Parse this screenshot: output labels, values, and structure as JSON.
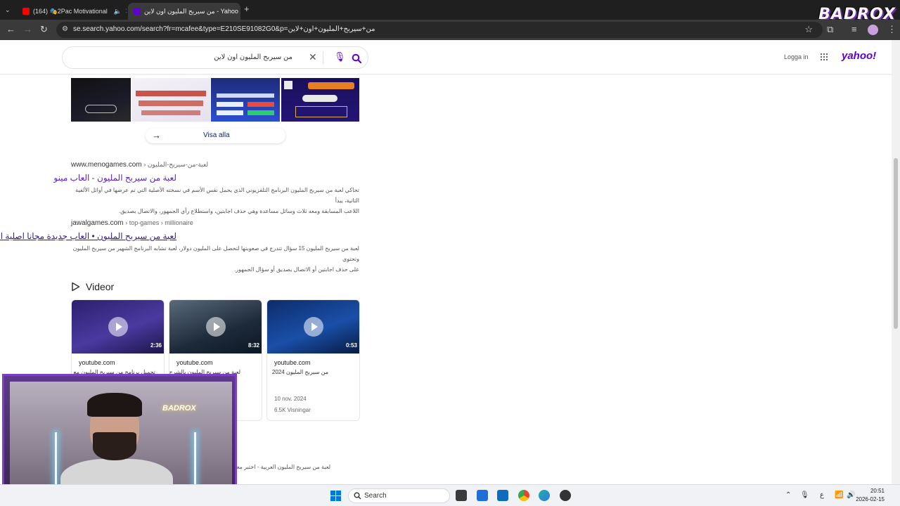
{
  "browser": {
    "tabs": [
      {
        "label": "(164) 🎭2Pac Motivational",
        "active": false
      },
      {
        "label": "من سيربح المليون اون لاين - Yahoo Resultat",
        "active": true
      }
    ],
    "url": "se.search.yahoo.com/search?fr=mcafee&type=E210SE91082G0&p=من+سيربح+المليون+اون+لاين",
    "overlay_logo": "BADROX"
  },
  "header": {
    "search_query": "من سيربح المليون اون لاين",
    "login_label": "Logga in",
    "logo": "yahoo!",
    "brand_color": "#6001d2"
  },
  "images": {
    "view_all_label": "Visa alla"
  },
  "results": [
    {
      "domain": "www.menogames.com",
      "crumb": "› لعبة-من-سيربح-المليون",
      "title": "لعبة من سيربح المليون - العاب مينو",
      "snippet_line1": "تحاكي لعبة من سيربح المليون البرنامج التلفزيوني الذي يحمل نفس الأسم في نسخته الأصلية التي تم عرضها في أوائل الألفية الثانية، يبدأ",
      "snippet_line2": "اللاعب المسابقة ومعه ثلاث وسائل مساعدة وهي حذف اجابتين، واستطلاع رأي الجمهور، والاتصال بصديق."
    },
    {
      "domain": "jawalgames.com",
      "crumb": "› top-games › millionaire",
      "title": "لعبة من سيربح المليون • العاب جديدة مجانا اصلية اون لاين",
      "snippet_line1": "لعبة من سيربح المليون 15 سؤال تتدرج في صعوبتها لتحصل على المليون دولار، لعبة تشابه البرنامج الشهير من سيربح المليون وتحتوي",
      "snippet_line2": "على حذف اجابتين أو الاتصال بصديق أو سؤال الجمهور."
    }
  ],
  "videos": {
    "heading": "Videor",
    "items": [
      {
        "source": "youtube.com",
        "title": "تحميل برنامج من سيربح المليون مع",
        "duration": "2:36",
        "date": "",
        "views": ""
      },
      {
        "source": "youtube.com",
        "title": "لعبة من سيربح المليون بالشرح",
        "duration": "8:32",
        "date": "",
        "views": ""
      },
      {
        "source": "youtube.com",
        "title": "من سيربح المليون 2024",
        "duration": "0:53",
        "date": "10 nov. 2024",
        "views": "6.5K Visningar"
      }
    ]
  },
  "bottom_snippet": "لعبة من سيربح المليون العربية - اختبر معلومـ",
  "webcam": {
    "neon_sign": "BADROX"
  },
  "taskbar": {
    "search_label": "Search",
    "time": "20:51",
    "date": "2026-02-15",
    "lang": "ع"
  }
}
